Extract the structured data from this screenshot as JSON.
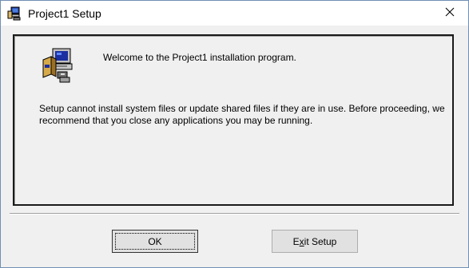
{
  "window": {
    "title": "Project1 Setup",
    "title_icon": "setup-computer-icon",
    "close_icon": "close-icon"
  },
  "panel": {
    "icon": "setup-computer-icon",
    "welcome_text": "Welcome to the Project1 installation program.",
    "description": "Setup cannot install system files or update shared files if they are in use. Before proceeding, we recommend that you close any applications you may be running."
  },
  "buttons": {
    "ok_label": "OK",
    "exit_prefix": "E",
    "exit_mnemonic": "x",
    "exit_suffix": "it Setup"
  },
  "colors": {
    "dialog_background": "#f0f0f0",
    "window_border": "#6f8fb3",
    "button_face": "#e1e1e1"
  }
}
